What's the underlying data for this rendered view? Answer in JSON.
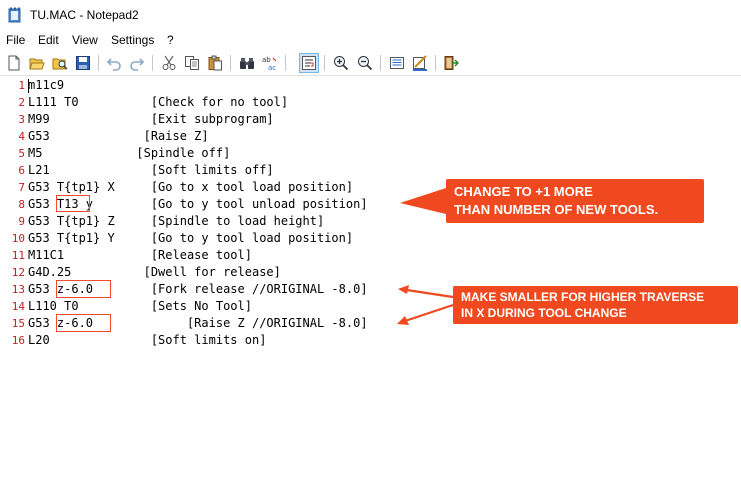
{
  "window": {
    "title": "TU.MAC - Notepad2",
    "app_icon": "notepad2-icon"
  },
  "menu": {
    "items": [
      "File",
      "Edit",
      "View",
      "Settings",
      "?"
    ]
  },
  "toolbar": {
    "buttons": [
      {
        "name": "new-file-icon"
      },
      {
        "name": "open-folder-icon"
      },
      {
        "name": "browse-icon"
      },
      {
        "name": "save-icon"
      },
      {
        "name": "undo-icon"
      },
      {
        "name": "redo-icon"
      },
      {
        "name": "cut-icon"
      },
      {
        "name": "copy-icon"
      },
      {
        "name": "paste-icon"
      },
      {
        "name": "find-icon"
      },
      {
        "name": "replace-icon"
      },
      {
        "name": "word-wrap-icon",
        "active": true
      },
      {
        "name": "zoom-in-icon"
      },
      {
        "name": "zoom-out-icon"
      },
      {
        "name": "scheme-icon"
      },
      {
        "name": "customize-schemes-icon"
      },
      {
        "name": "exit-icon"
      }
    ]
  },
  "editor": {
    "lines": [
      {
        "num": "1",
        "text": "m11c9"
      },
      {
        "num": "2",
        "text": "L111 T0          [Check for no tool]"
      },
      {
        "num": "3",
        "text": "M99              [Exit subprogram]"
      },
      {
        "num": "4",
        "text": "G53             [Raise Z]"
      },
      {
        "num": "5",
        "text": "M5             [Spindle off]"
      },
      {
        "num": "6",
        "text": "L21              [Soft limits off]"
      },
      {
        "num": "7",
        "text": "G53 T{tp1} X     [Go to x tool load position]"
      },
      {
        "num": "8",
        "text": "G53 T13 y        [Go to y tool unload position]"
      },
      {
        "num": "9",
        "text": "G53 T{tp1} Z     [Spindle to load height]"
      },
      {
        "num": "10",
        "text": "G53 T{tp1} Y     [Go to y tool load position]"
      },
      {
        "num": "11",
        "text": "M11C1            [Release tool]"
      },
      {
        "num": "12",
        "text": "G4D.25          [Dwell for release]"
      },
      {
        "num": "13",
        "text": "G53 z-6.0        [Fork release //ORIGINAL -8.0]"
      },
      {
        "num": "14",
        "text": "L110 T0          [Sets No Tool]"
      },
      {
        "num": "15",
        "text": "G53 z-6.0             [Raise Z //ORIGINAL -8.0]"
      },
      {
        "num": "16",
        "text": "L20              [Soft limits on]"
      }
    ]
  },
  "annotations": {
    "callout_1": {
      "line1": "CHANGE TO +1 MORE",
      "line2": "THAN NUMBER OF NEW TOOLS."
    },
    "callout_2": {
      "line1": "MAKE SMALLER FOR HIGHER TRAVERSE",
      "line2": "IN X DURING TOOL CHANGE"
    },
    "accent_color": "#f0491f"
  }
}
